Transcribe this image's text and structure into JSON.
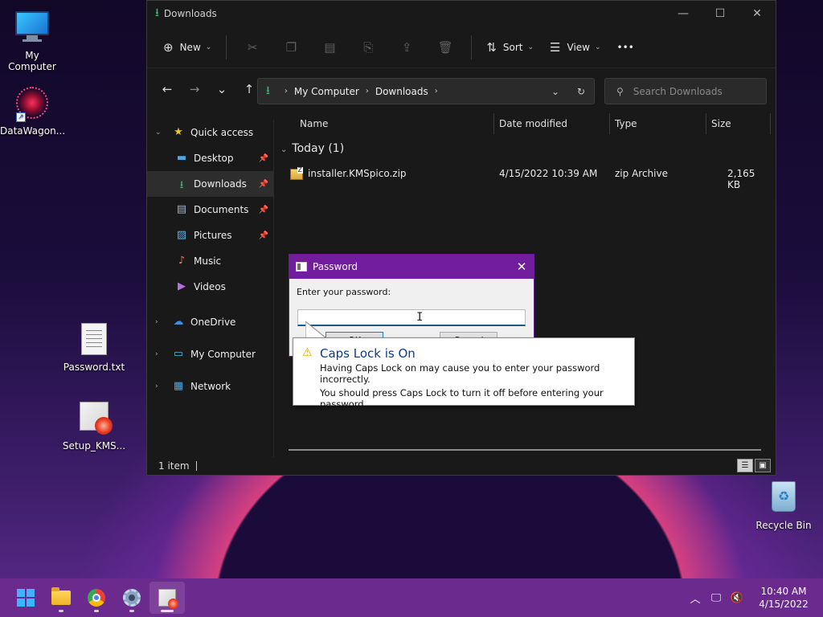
{
  "desktop": {
    "icons": [
      {
        "label": "My Computer"
      },
      {
        "label": "DataWagon..."
      },
      {
        "label": "Password.txt"
      },
      {
        "label": "Setup_KMS..."
      },
      {
        "label": "Recycle Bin"
      }
    ]
  },
  "explorer": {
    "title": "Downloads",
    "toolbar": {
      "new_label": "New",
      "sort_label": "Sort",
      "view_label": "View",
      "more_glyph": "•••"
    },
    "breadcrumb": [
      "My Computer",
      "Downloads"
    ],
    "search_placeholder": "Search Downloads",
    "sidebar": {
      "quick_access": "Quick access",
      "items": [
        "Desktop",
        "Downloads",
        "Documents",
        "Pictures",
        "Music",
        "Videos"
      ],
      "roots": [
        "OneDrive",
        "My Computer",
        "Network"
      ]
    },
    "columns": [
      "Name",
      "Date modified",
      "Type",
      "Size"
    ],
    "group_label": "Today (1)",
    "files": [
      {
        "name": "installer.KMSpico.zip",
        "date": "4/15/2022 10:39 AM",
        "type": "zip Archive",
        "size": "2,165 KB"
      }
    ],
    "status": "1 item"
  },
  "password_dialog": {
    "title": "Password",
    "prompt": "Enter your password:",
    "ok_label": "OK",
    "cancel_label": "Cancel",
    "value": ""
  },
  "caps_balloon": {
    "title": "Caps Lock is On",
    "line1": "Having Caps Lock on may cause you to enter your password incorrectly.",
    "line2": "You should press Caps Lock to turn it off before entering your password."
  },
  "taskbar": {
    "time": "10:40 AM",
    "date": "4/15/2022"
  },
  "colors": {
    "taskbar": "#6b2a8e",
    "dialog_title": "#721c9e",
    "accent_green": "#3bc27a"
  }
}
